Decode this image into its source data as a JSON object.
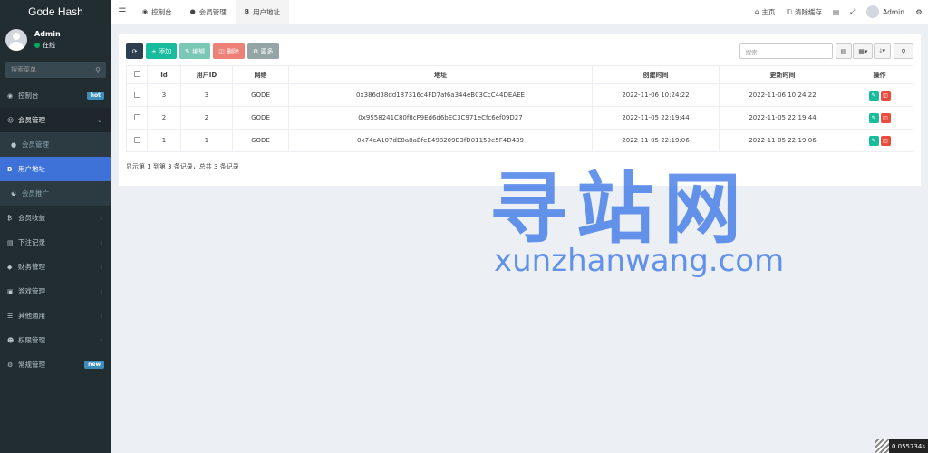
{
  "app": {
    "brand": "Gode Hash"
  },
  "user": {
    "name": "Admin",
    "status": "在线"
  },
  "sidebar": {
    "search_placeholder": "搜索菜单",
    "items": [
      {
        "label": "控制台",
        "icon": "dashboard-icon",
        "badge": "hot"
      },
      {
        "label": "会员管理",
        "icon": "user-circle-icon"
      },
      {
        "label": "会员管理",
        "icon": "user-icon"
      },
      {
        "label": "用户地址",
        "icon": "address-icon"
      },
      {
        "label": "会员推广",
        "icon": "handshake-icon"
      },
      {
        "label": "会员收益",
        "icon": "bitcoin-icon"
      },
      {
        "label": "下注记录",
        "icon": "file-icon"
      },
      {
        "label": "财务管理",
        "icon": "diamond-icon"
      },
      {
        "label": "游戏管理",
        "icon": "gamepad-icon"
      },
      {
        "label": "其他通用",
        "icon": "list-icon"
      },
      {
        "label": "权限管理",
        "icon": "users-icon"
      },
      {
        "label": "常规管理",
        "icon": "cogs-icon",
        "badge": "new"
      }
    ]
  },
  "header": {
    "tabs": [
      {
        "label": "控制台"
      },
      {
        "label": "会员管理"
      },
      {
        "label": "用户地址"
      }
    ],
    "home": "主页",
    "clear_cache": "清除缓存",
    "admin": "Admin"
  },
  "toolbar": {
    "add": "添加",
    "edit": "编辑",
    "delete": "删除",
    "more": "更多",
    "search_placeholder": "搜索"
  },
  "table": {
    "headers": [
      "Id",
      "用户ID",
      "网络",
      "地址",
      "创建时间",
      "更新时间",
      "操作"
    ],
    "rows": [
      {
        "id": "3",
        "uid": "3",
        "net": "GODE",
        "addr": "0x386d38dd187316c4FD7af6a344eB03CcC44DEAEE",
        "created": "2022-11-06 10:24:22",
        "updated": "2022-11-06 10:24:22"
      },
      {
        "id": "2",
        "uid": "2",
        "net": "GODE",
        "addr": "0x9558241C80f8cF9Ed6d6bEC3C971eCfc6ef09D27",
        "created": "2022-11-05 22:19:44",
        "updated": "2022-11-05 22:19:44"
      },
      {
        "id": "1",
        "uid": "1",
        "net": "GODE",
        "addr": "0x74cA107dE8a8aBfeE498209B3fD01159e5F4D439",
        "created": "2022-11-05 22:19:06",
        "updated": "2022-11-05 22:19:06"
      }
    ],
    "summary": "显示第 1 到第 3 条记录，总共 3 条记录"
  },
  "watermark": {
    "big": "寻站网",
    "small": "xunzhanwang.com"
  },
  "timer": "0.055734s"
}
